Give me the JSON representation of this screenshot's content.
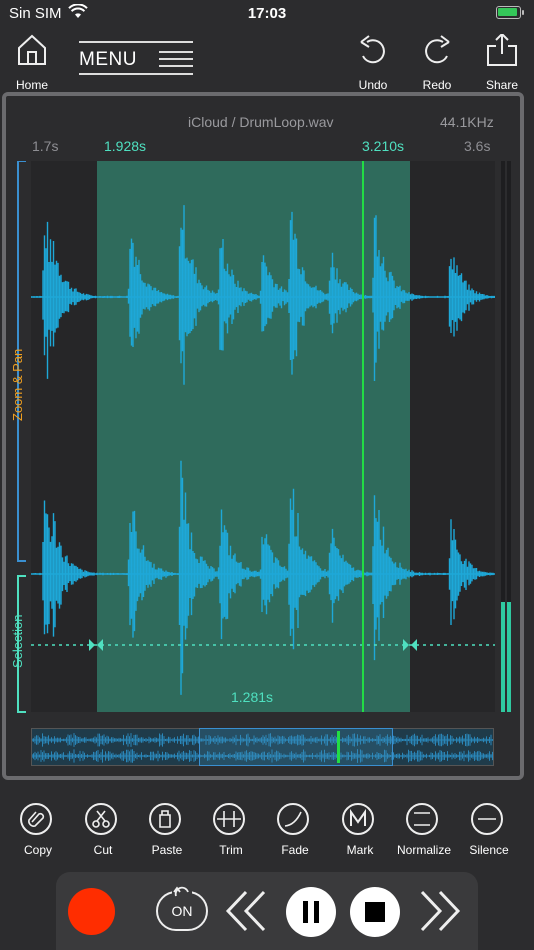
{
  "status_bar": {
    "carrier": "Sin SIM",
    "time": "17:03"
  },
  "toolbar": {
    "home_label": "Home",
    "menu_label": "MENU",
    "undo_label": "Undo",
    "redo_label": "Redo",
    "share_label": "Share"
  },
  "editor": {
    "file_path": "iCloud / DrumLoop.wav",
    "sample_rate": "44.1KHz",
    "view_start": "1.7s",
    "selection_start": "1.928s",
    "playhead_time": "3.210s",
    "view_end": "3.6s",
    "selection_length": "1.281s",
    "zoom_pan_label": "Zoom & Pan",
    "selection_label": "Selection"
  },
  "edit_tools": [
    {
      "label": "Copy",
      "icon": "paperclip-icon"
    },
    {
      "label": "Cut",
      "icon": "scissors-icon"
    },
    {
      "label": "Paste",
      "icon": "paste-icon"
    },
    {
      "label": "Trim",
      "icon": "trim-icon"
    },
    {
      "label": "Fade",
      "icon": "fade-curve-icon"
    },
    {
      "label": "Mark",
      "icon": "mark-m-icon"
    },
    {
      "label": "Normalize",
      "icon": "normalize-icon"
    },
    {
      "label": "Silence",
      "icon": "silence-icon"
    }
  ],
  "transport": {
    "loop_label": "ON"
  },
  "colors": {
    "waveform": "#1ea8d8",
    "selection": "#2f6b5c",
    "playhead": "#22dd44",
    "selection_text": "#4fe0c0",
    "scale_orange": "#f0a020",
    "record": "#ff2d00"
  }
}
